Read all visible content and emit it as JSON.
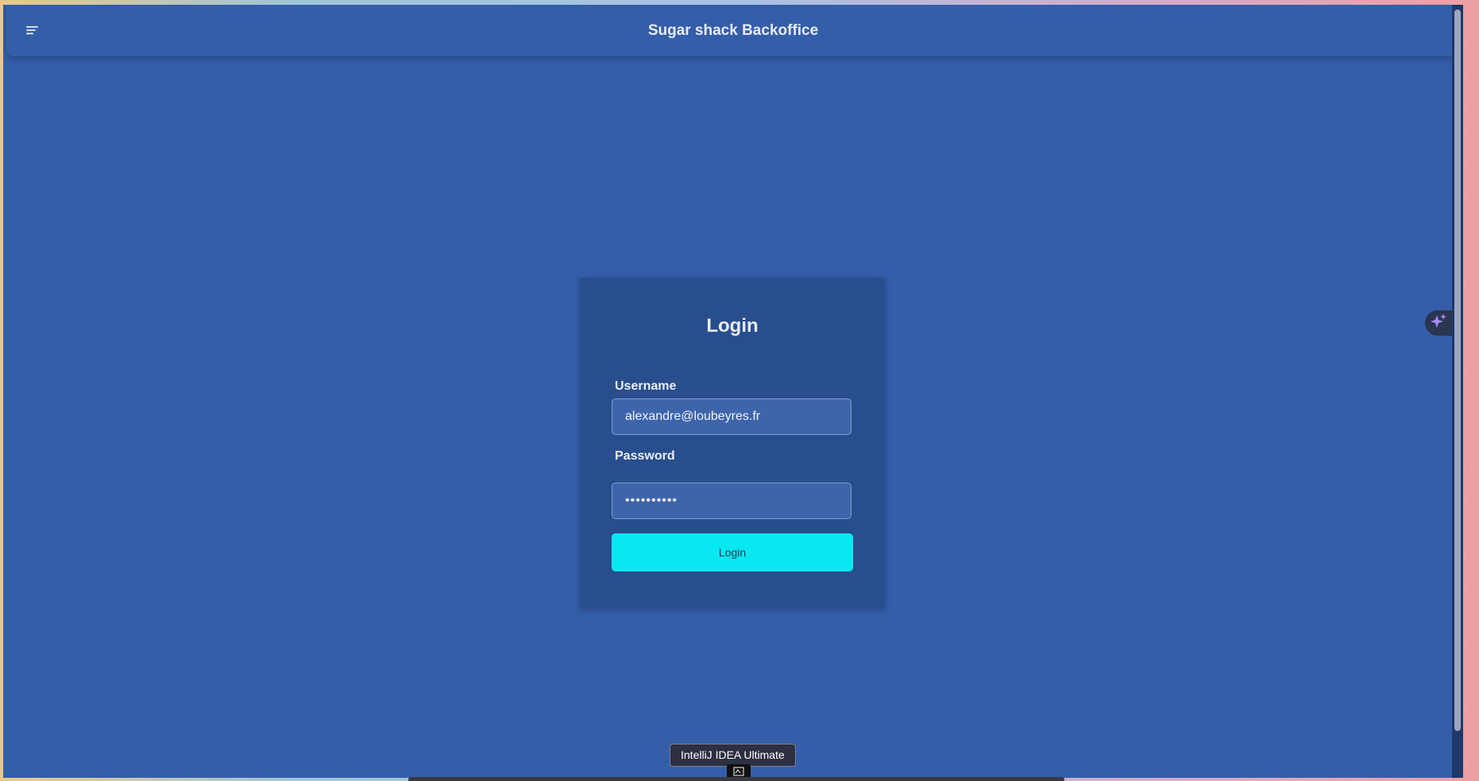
{
  "app": {
    "title": "Sugar shack Backoffice"
  },
  "login": {
    "title": "Login",
    "username_label": "Username",
    "username_value": "alexandre@loubeyres.fr",
    "password_label": "Password",
    "password_value": "••••••••••",
    "button_label": "Login"
  },
  "os": {
    "tooltip": "IntelliJ IDEA Ultimate"
  },
  "icons": {
    "menu": "menu-icon",
    "ai": "sparkle-icon",
    "dock": "intellij-icon"
  },
  "colors": {
    "background": "#355ea9",
    "card": "#294e8d",
    "accent_button": "#08e8f0",
    "sparkle": "#a98cf5"
  }
}
